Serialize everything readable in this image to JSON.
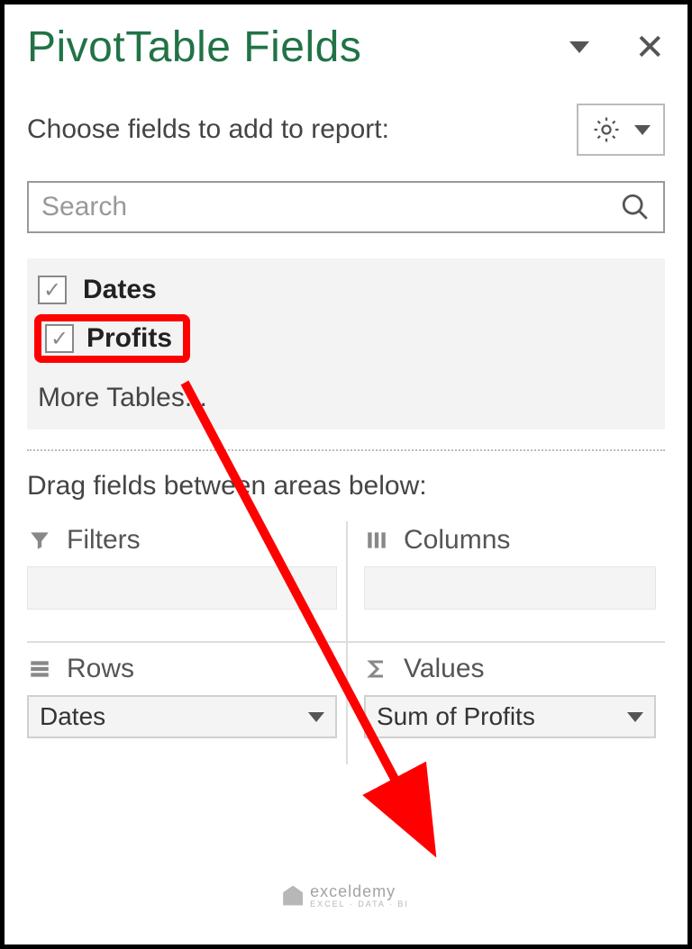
{
  "header": {
    "title": "PivotTable Fields"
  },
  "subheader": "Choose fields to add to report:",
  "search": {
    "placeholder": "Search"
  },
  "fields": {
    "items": [
      {
        "label": "Dates",
        "checked": true
      },
      {
        "label": "Profits",
        "checked": true
      }
    ],
    "more": "More Tables..."
  },
  "drag_label": "Drag fields between areas below:",
  "areas": {
    "filters": {
      "label": "Filters"
    },
    "columns": {
      "label": "Columns"
    },
    "rows": {
      "label": "Rows",
      "item": "Dates"
    },
    "values": {
      "label": "Values",
      "item": "Sum of Profits"
    }
  },
  "watermark": {
    "text": "exceldemy",
    "subtext": "EXCEL · DATA · BI"
  }
}
